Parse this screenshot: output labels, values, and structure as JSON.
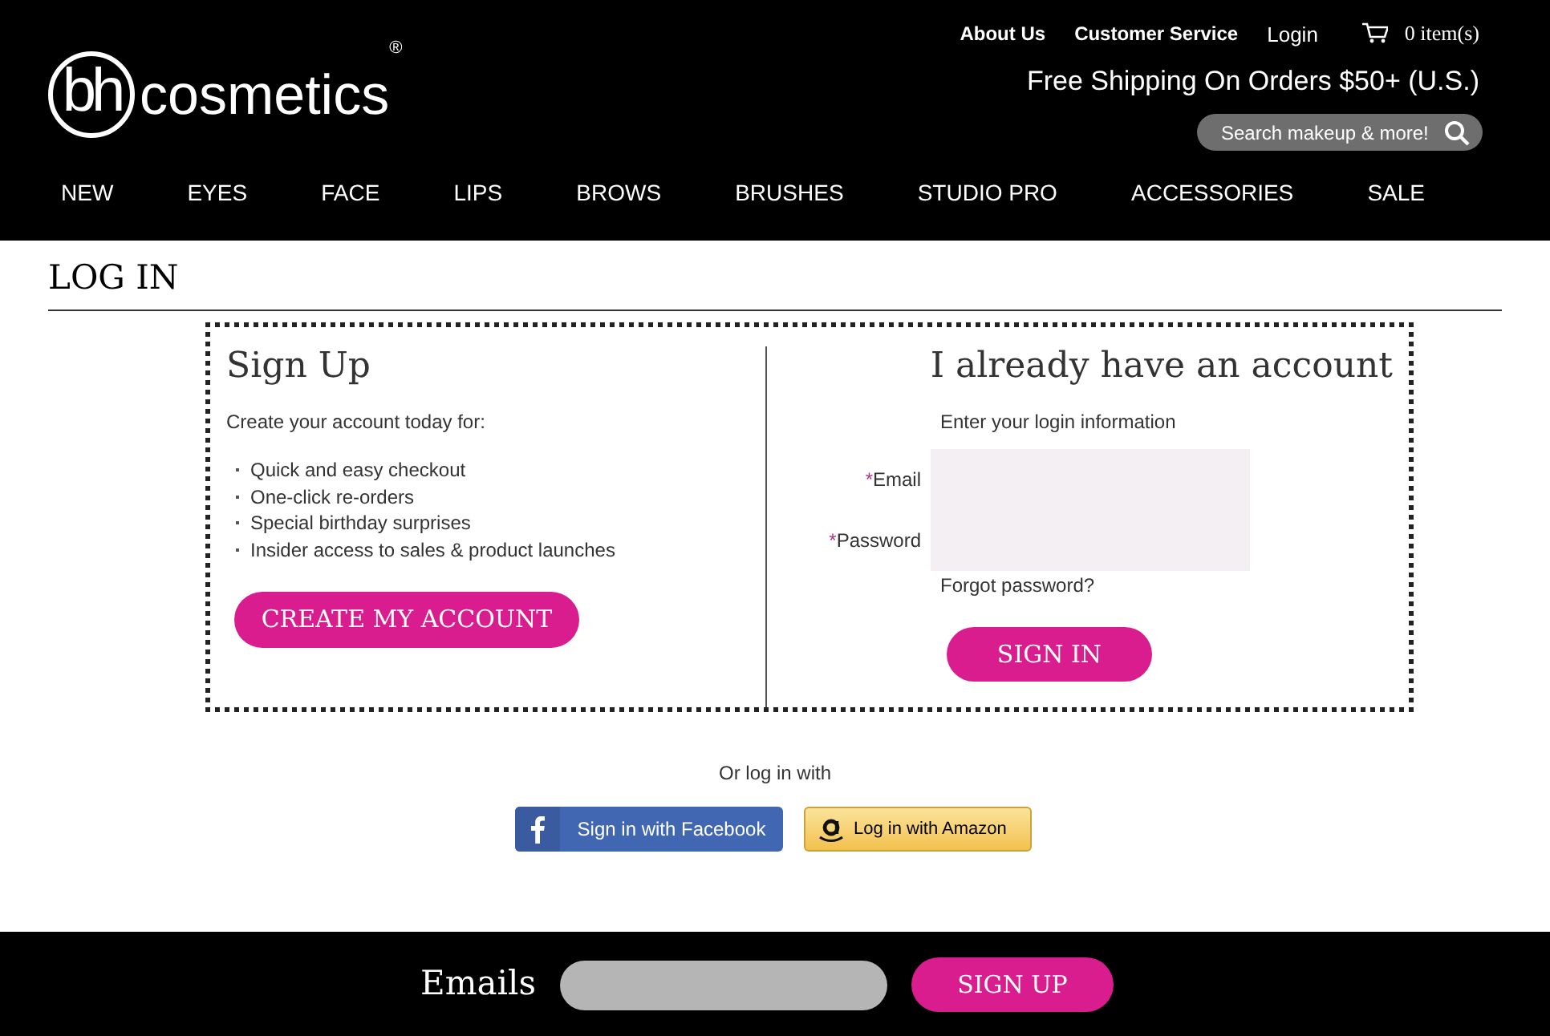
{
  "logo": {
    "mark": "bh",
    "word": "cosmetics",
    "registered": "®"
  },
  "top_links": [
    "About Us",
    "Customer Service",
    "Login"
  ],
  "cart": {
    "count": "0",
    "label": "item(s)"
  },
  "shipping": "Free Shipping On Orders $50+ (U.S.)",
  "search": {
    "placeholder": "Search makeup & more!"
  },
  "nav": [
    "NEW",
    "EYES",
    "FACE",
    "LIPS",
    "BROWS",
    "BRUSHES",
    "STUDIO PRO",
    "ACCESSORIES",
    "SALE"
  ],
  "page_title": "LOG IN",
  "signup": {
    "heading": "Sign Up",
    "intro": "Create your account today for:",
    "benefits": [
      "Quick and easy checkout",
      "One-click re-orders",
      "Special birthday surprises",
      "Insider access to sales & product launches"
    ],
    "button": "CREATE MY ACCOUNT"
  },
  "login": {
    "heading": "I already have an account",
    "intro": "Enter your login information",
    "fields": [
      {
        "label": "Email",
        "required_mark": "*"
      },
      {
        "label": "Password",
        "required_mark": "*"
      }
    ],
    "forgot": "Forgot password?",
    "button": "SIGN IN"
  },
  "social": {
    "intro": "Or log in with",
    "buttons": [
      {
        "kind": "facebook",
        "label": "Sign in with Facebook"
      },
      {
        "kind": "amazon",
        "label": "Log in with Amazon"
      }
    ]
  },
  "footer": {
    "label": "Emails",
    "button": "SIGN UP"
  }
}
